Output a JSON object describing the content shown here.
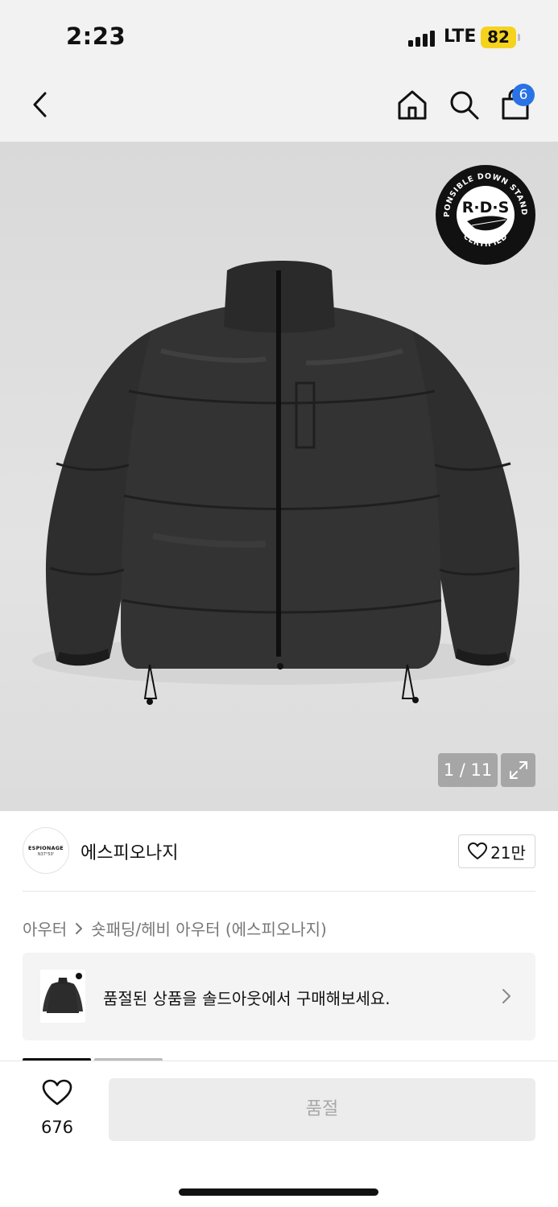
{
  "status_bar": {
    "time": "2:23",
    "network": "LTE",
    "battery": "82"
  },
  "nav": {
    "back_icon": "chevron-left-icon",
    "home_icon": "home-icon",
    "search_icon": "search-icon",
    "cart_icon": "shopping-bag-icon",
    "cart_count": "6",
    "badge_color": "#2a72e5"
  },
  "hero": {
    "seal": {
      "center_text": "R·D·S",
      "ring_top": "RESPONSIBLE DOWN STANDARD",
      "ring_bottom": "CERTIFIED"
    },
    "counter": "1 / 11",
    "expand_icon": "expand-icon"
  },
  "brand": {
    "logo_line1": "ESPIONAGE",
    "logo_line2": "N37°50'",
    "name": "에스피오나지",
    "like_count": "21만"
  },
  "breadcrumb": {
    "category": "아우터",
    "subcategory": "숏패딩/헤비 아우터 (에스피오나지)"
  },
  "soldout_banner": {
    "text": "품절된 상품을 솔드아웃에서 구매해보세요."
  },
  "bottom_bar": {
    "wish_count": "676",
    "action_label": "품절"
  },
  "colors": {
    "chrome_bg": "#f2f2f2",
    "battery": "#f5d31d",
    "disabled_button": "#ececec"
  }
}
